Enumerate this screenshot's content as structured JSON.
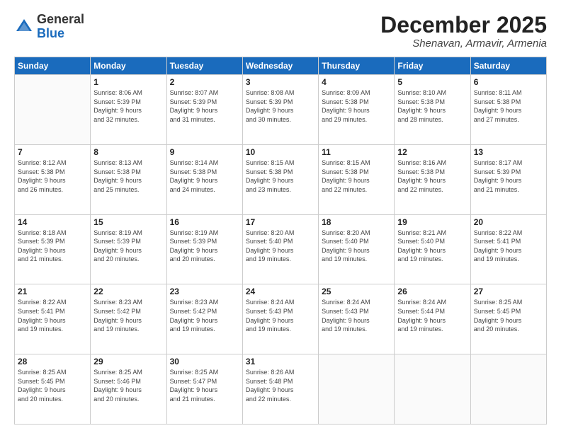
{
  "header": {
    "logo_general": "General",
    "logo_blue": "Blue",
    "month_title": "December 2025",
    "location": "Shenavan, Armavir, Armenia"
  },
  "days_of_week": [
    "Sunday",
    "Monday",
    "Tuesday",
    "Wednesday",
    "Thursday",
    "Friday",
    "Saturday"
  ],
  "weeks": [
    [
      {
        "day": "",
        "info": ""
      },
      {
        "day": "1",
        "info": "Sunrise: 8:06 AM\nSunset: 5:39 PM\nDaylight: 9 hours\nand 32 minutes."
      },
      {
        "day": "2",
        "info": "Sunrise: 8:07 AM\nSunset: 5:39 PM\nDaylight: 9 hours\nand 31 minutes."
      },
      {
        "day": "3",
        "info": "Sunrise: 8:08 AM\nSunset: 5:39 PM\nDaylight: 9 hours\nand 30 minutes."
      },
      {
        "day": "4",
        "info": "Sunrise: 8:09 AM\nSunset: 5:38 PM\nDaylight: 9 hours\nand 29 minutes."
      },
      {
        "day": "5",
        "info": "Sunrise: 8:10 AM\nSunset: 5:38 PM\nDaylight: 9 hours\nand 28 minutes."
      },
      {
        "day": "6",
        "info": "Sunrise: 8:11 AM\nSunset: 5:38 PM\nDaylight: 9 hours\nand 27 minutes."
      }
    ],
    [
      {
        "day": "7",
        "info": "Sunrise: 8:12 AM\nSunset: 5:38 PM\nDaylight: 9 hours\nand 26 minutes."
      },
      {
        "day": "8",
        "info": "Sunrise: 8:13 AM\nSunset: 5:38 PM\nDaylight: 9 hours\nand 25 minutes."
      },
      {
        "day": "9",
        "info": "Sunrise: 8:14 AM\nSunset: 5:38 PM\nDaylight: 9 hours\nand 24 minutes."
      },
      {
        "day": "10",
        "info": "Sunrise: 8:15 AM\nSunset: 5:38 PM\nDaylight: 9 hours\nand 23 minutes."
      },
      {
        "day": "11",
        "info": "Sunrise: 8:15 AM\nSunset: 5:38 PM\nDaylight: 9 hours\nand 22 minutes."
      },
      {
        "day": "12",
        "info": "Sunrise: 8:16 AM\nSunset: 5:38 PM\nDaylight: 9 hours\nand 22 minutes."
      },
      {
        "day": "13",
        "info": "Sunrise: 8:17 AM\nSunset: 5:39 PM\nDaylight: 9 hours\nand 21 minutes."
      }
    ],
    [
      {
        "day": "14",
        "info": "Sunrise: 8:18 AM\nSunset: 5:39 PM\nDaylight: 9 hours\nand 21 minutes."
      },
      {
        "day": "15",
        "info": "Sunrise: 8:19 AM\nSunset: 5:39 PM\nDaylight: 9 hours\nand 20 minutes."
      },
      {
        "day": "16",
        "info": "Sunrise: 8:19 AM\nSunset: 5:39 PM\nDaylight: 9 hours\nand 20 minutes."
      },
      {
        "day": "17",
        "info": "Sunrise: 8:20 AM\nSunset: 5:40 PM\nDaylight: 9 hours\nand 19 minutes."
      },
      {
        "day": "18",
        "info": "Sunrise: 8:20 AM\nSunset: 5:40 PM\nDaylight: 9 hours\nand 19 minutes."
      },
      {
        "day": "19",
        "info": "Sunrise: 8:21 AM\nSunset: 5:40 PM\nDaylight: 9 hours\nand 19 minutes."
      },
      {
        "day": "20",
        "info": "Sunrise: 8:22 AM\nSunset: 5:41 PM\nDaylight: 9 hours\nand 19 minutes."
      }
    ],
    [
      {
        "day": "21",
        "info": "Sunrise: 8:22 AM\nSunset: 5:41 PM\nDaylight: 9 hours\nand 19 minutes."
      },
      {
        "day": "22",
        "info": "Sunrise: 8:23 AM\nSunset: 5:42 PM\nDaylight: 9 hours\nand 19 minutes."
      },
      {
        "day": "23",
        "info": "Sunrise: 8:23 AM\nSunset: 5:42 PM\nDaylight: 9 hours\nand 19 minutes."
      },
      {
        "day": "24",
        "info": "Sunrise: 8:24 AM\nSunset: 5:43 PM\nDaylight: 9 hours\nand 19 minutes."
      },
      {
        "day": "25",
        "info": "Sunrise: 8:24 AM\nSunset: 5:43 PM\nDaylight: 9 hours\nand 19 minutes."
      },
      {
        "day": "26",
        "info": "Sunrise: 8:24 AM\nSunset: 5:44 PM\nDaylight: 9 hours\nand 19 minutes."
      },
      {
        "day": "27",
        "info": "Sunrise: 8:25 AM\nSunset: 5:45 PM\nDaylight: 9 hours\nand 20 minutes."
      }
    ],
    [
      {
        "day": "28",
        "info": "Sunrise: 8:25 AM\nSunset: 5:45 PM\nDaylight: 9 hours\nand 20 minutes."
      },
      {
        "day": "29",
        "info": "Sunrise: 8:25 AM\nSunset: 5:46 PM\nDaylight: 9 hours\nand 20 minutes."
      },
      {
        "day": "30",
        "info": "Sunrise: 8:25 AM\nSunset: 5:47 PM\nDaylight: 9 hours\nand 21 minutes."
      },
      {
        "day": "31",
        "info": "Sunrise: 8:26 AM\nSunset: 5:48 PM\nDaylight: 9 hours\nand 22 minutes."
      },
      {
        "day": "",
        "info": ""
      },
      {
        "day": "",
        "info": ""
      },
      {
        "day": "",
        "info": ""
      }
    ]
  ]
}
